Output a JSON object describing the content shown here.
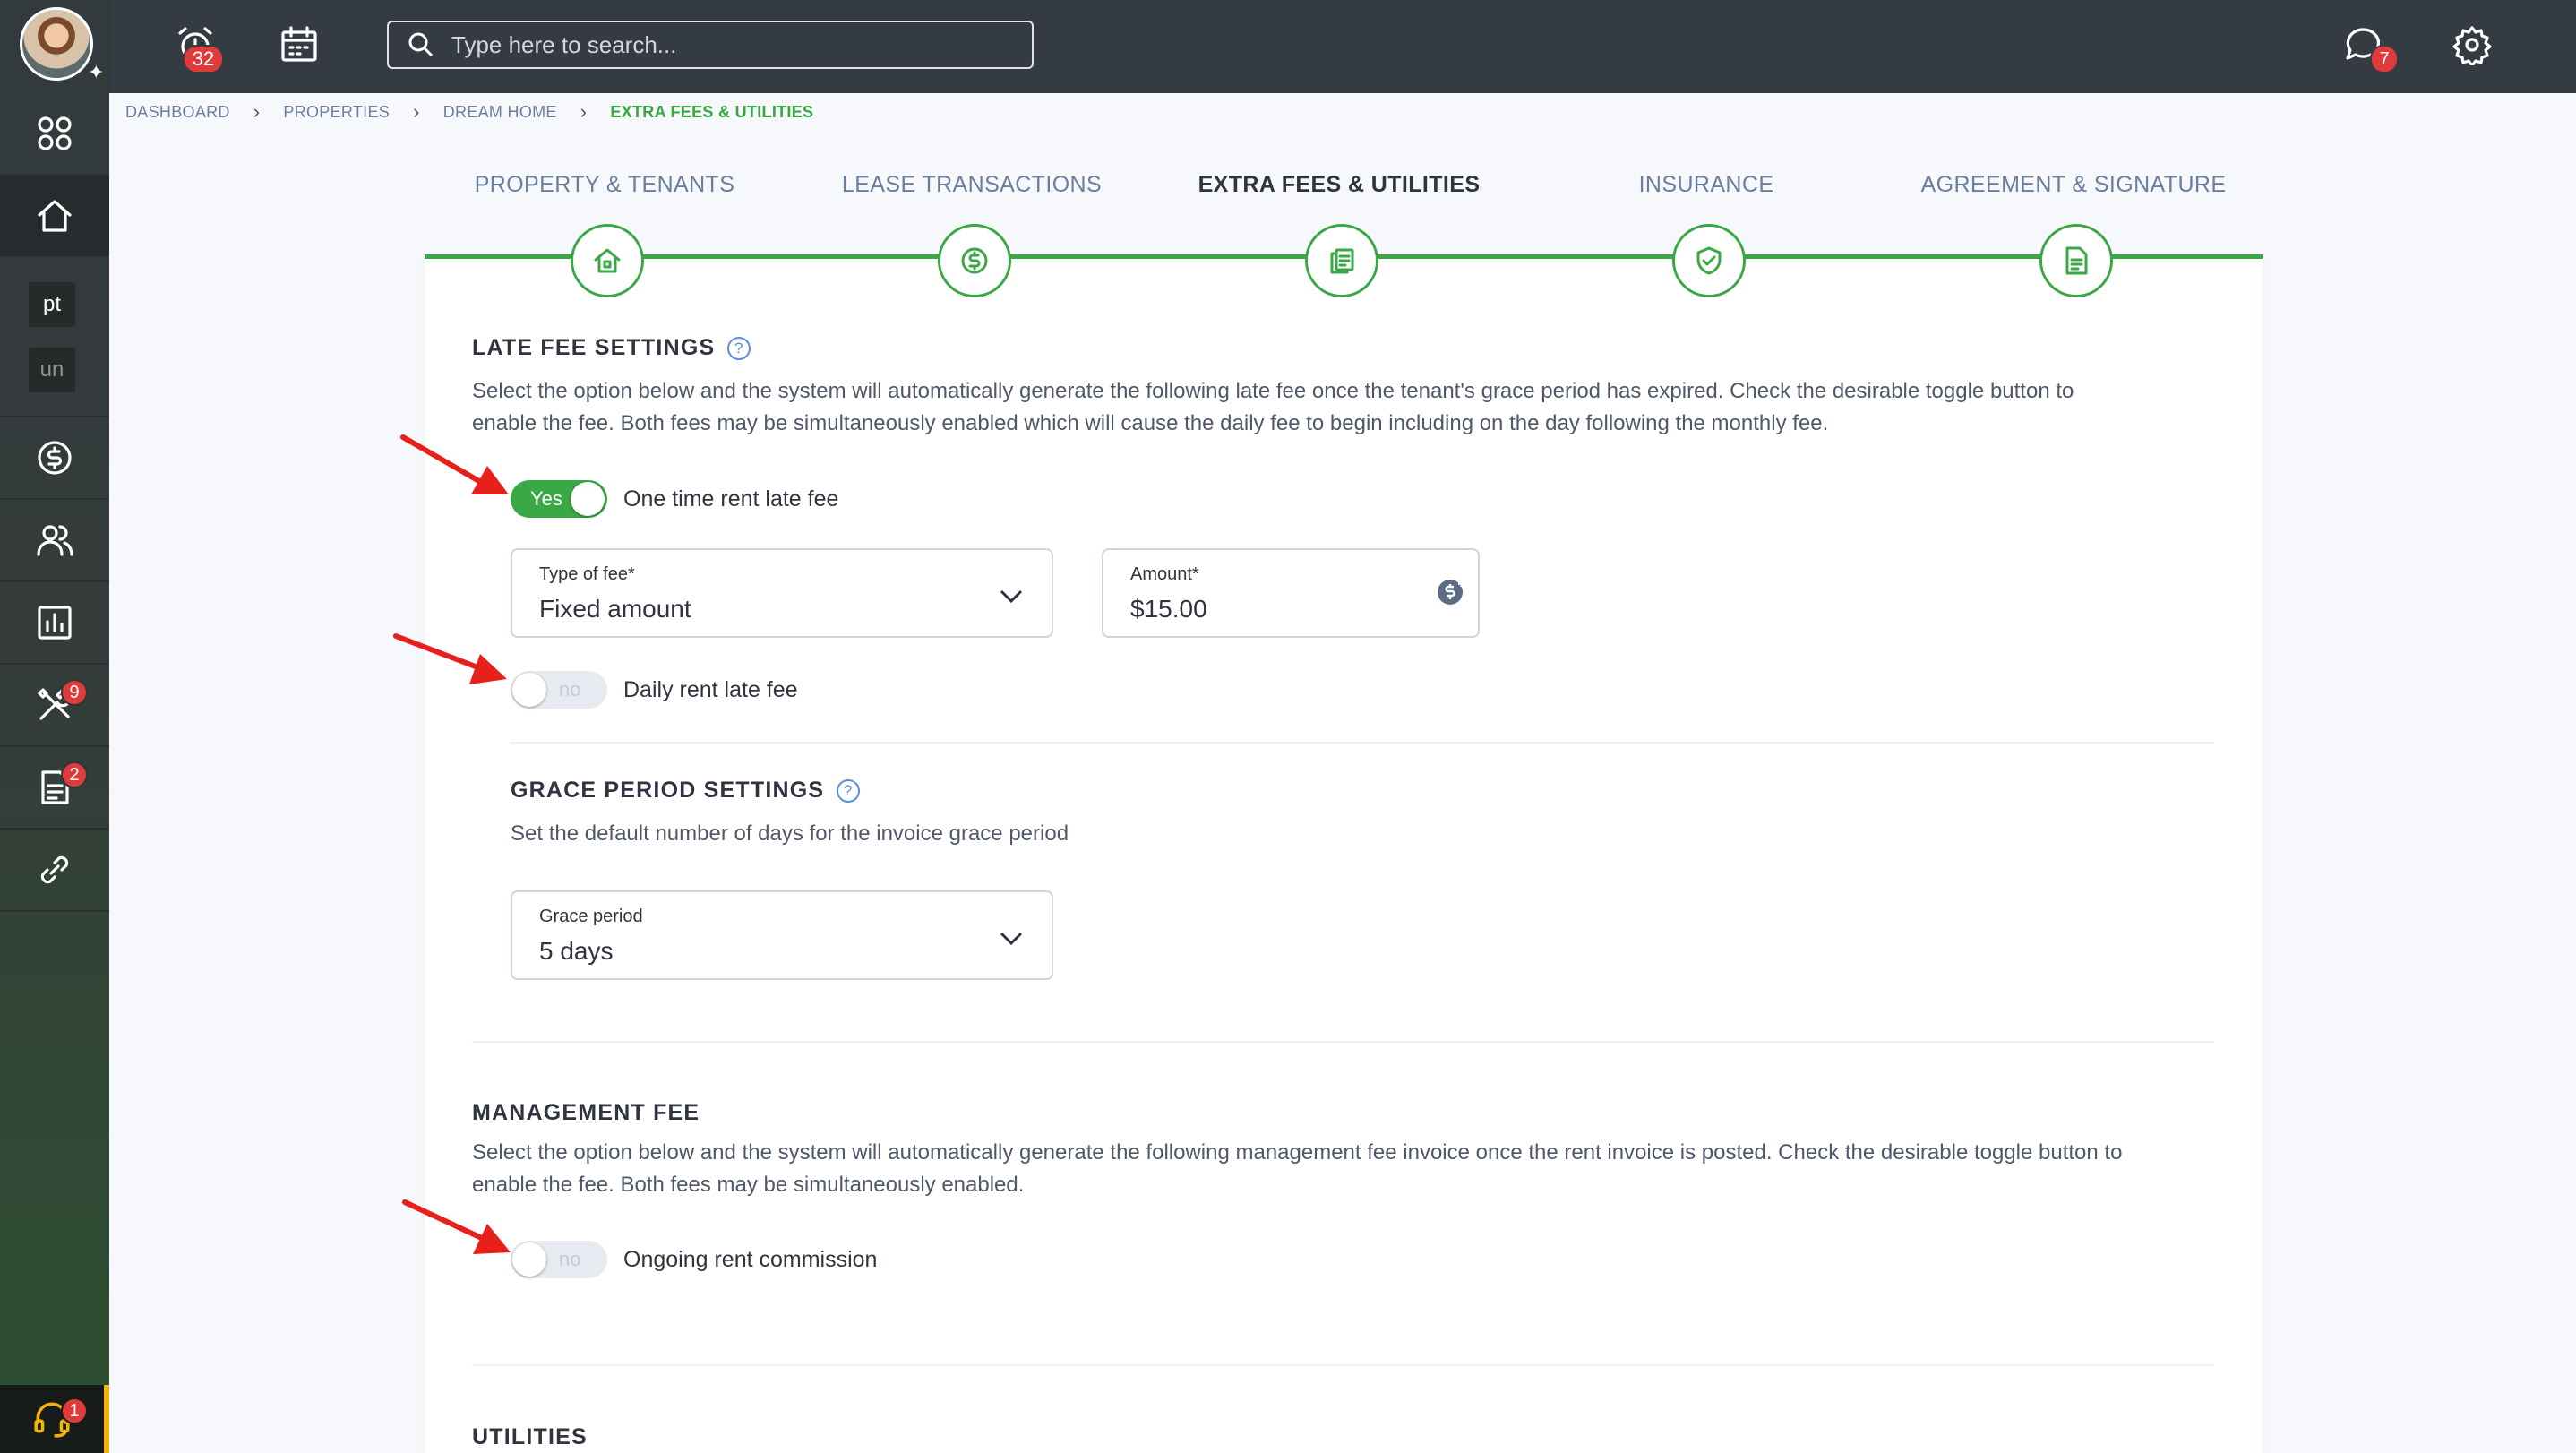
{
  "sidebar": {
    "chips": [
      "pt",
      "un"
    ],
    "badges": {
      "maintenance": "9",
      "documents": "2",
      "support": "1"
    }
  },
  "topbar": {
    "notifications_count": "32",
    "messages_count": "7",
    "search_placeholder": "Type here to search..."
  },
  "breadcrumb": [
    "DASHBOARD",
    "PROPERTIES",
    "DREAM HOME",
    "EXTRA FEES & UTILITIES"
  ],
  "steps": [
    {
      "label": "PROPERTY & TENANTS",
      "icon": "home-icon"
    },
    {
      "label": "LEASE TRANSACTIONS",
      "icon": "dollar-icon"
    },
    {
      "label": "EXTRA FEES & UTILITIES",
      "icon": "documents-icon",
      "active": true
    },
    {
      "label": "INSURANCE",
      "icon": "shield-icon"
    },
    {
      "label": "AGREEMENT & SIGNATURE",
      "icon": "file-icon"
    }
  ],
  "late_fee": {
    "title": "LATE FEE SETTINGS",
    "help": "?",
    "description_line1": "Select the option below and the system will automatically generate the following late fee once the tenant's grace period has expired. Check the desirable toggle button to",
    "description_line2": "enable the fee. Both fees may be simultaneously enabled which will cause the daily fee to begin including on the day following the monthly fee.",
    "one_time_toggle": {
      "state": "Yes",
      "label": "One time rent late fee"
    },
    "type_of_fee": {
      "label": "Type of fee*",
      "value": "Fixed amount"
    },
    "amount": {
      "label": "Amount*",
      "value": "$15.00"
    },
    "daily_toggle": {
      "state": "no",
      "label": "Daily rent late fee"
    }
  },
  "grace_period": {
    "title": "GRACE PERIOD SETTINGS",
    "help": "?",
    "description": "Set the default number of days for the invoice grace period",
    "field": {
      "label": "Grace period",
      "value": "5 days"
    }
  },
  "management_fee": {
    "title": "MANAGEMENT FEE",
    "description_line1": "Select the option below and the system will automatically generate the following management fee invoice once the rent invoice is posted. Check the desirable toggle button to",
    "description_line2": "enable the fee. Both fees may be simultaneously enabled.",
    "commission_toggle": {
      "state": "no",
      "label": "Ongoing rent commission"
    }
  },
  "utilities": {
    "title": "UTILITIES"
  },
  "colors": {
    "accent": "#3aa844",
    "badge": "#e03b3b",
    "sidebar": "#333a3d",
    "topbar": "#353b42",
    "arrow": "#e8201c"
  }
}
